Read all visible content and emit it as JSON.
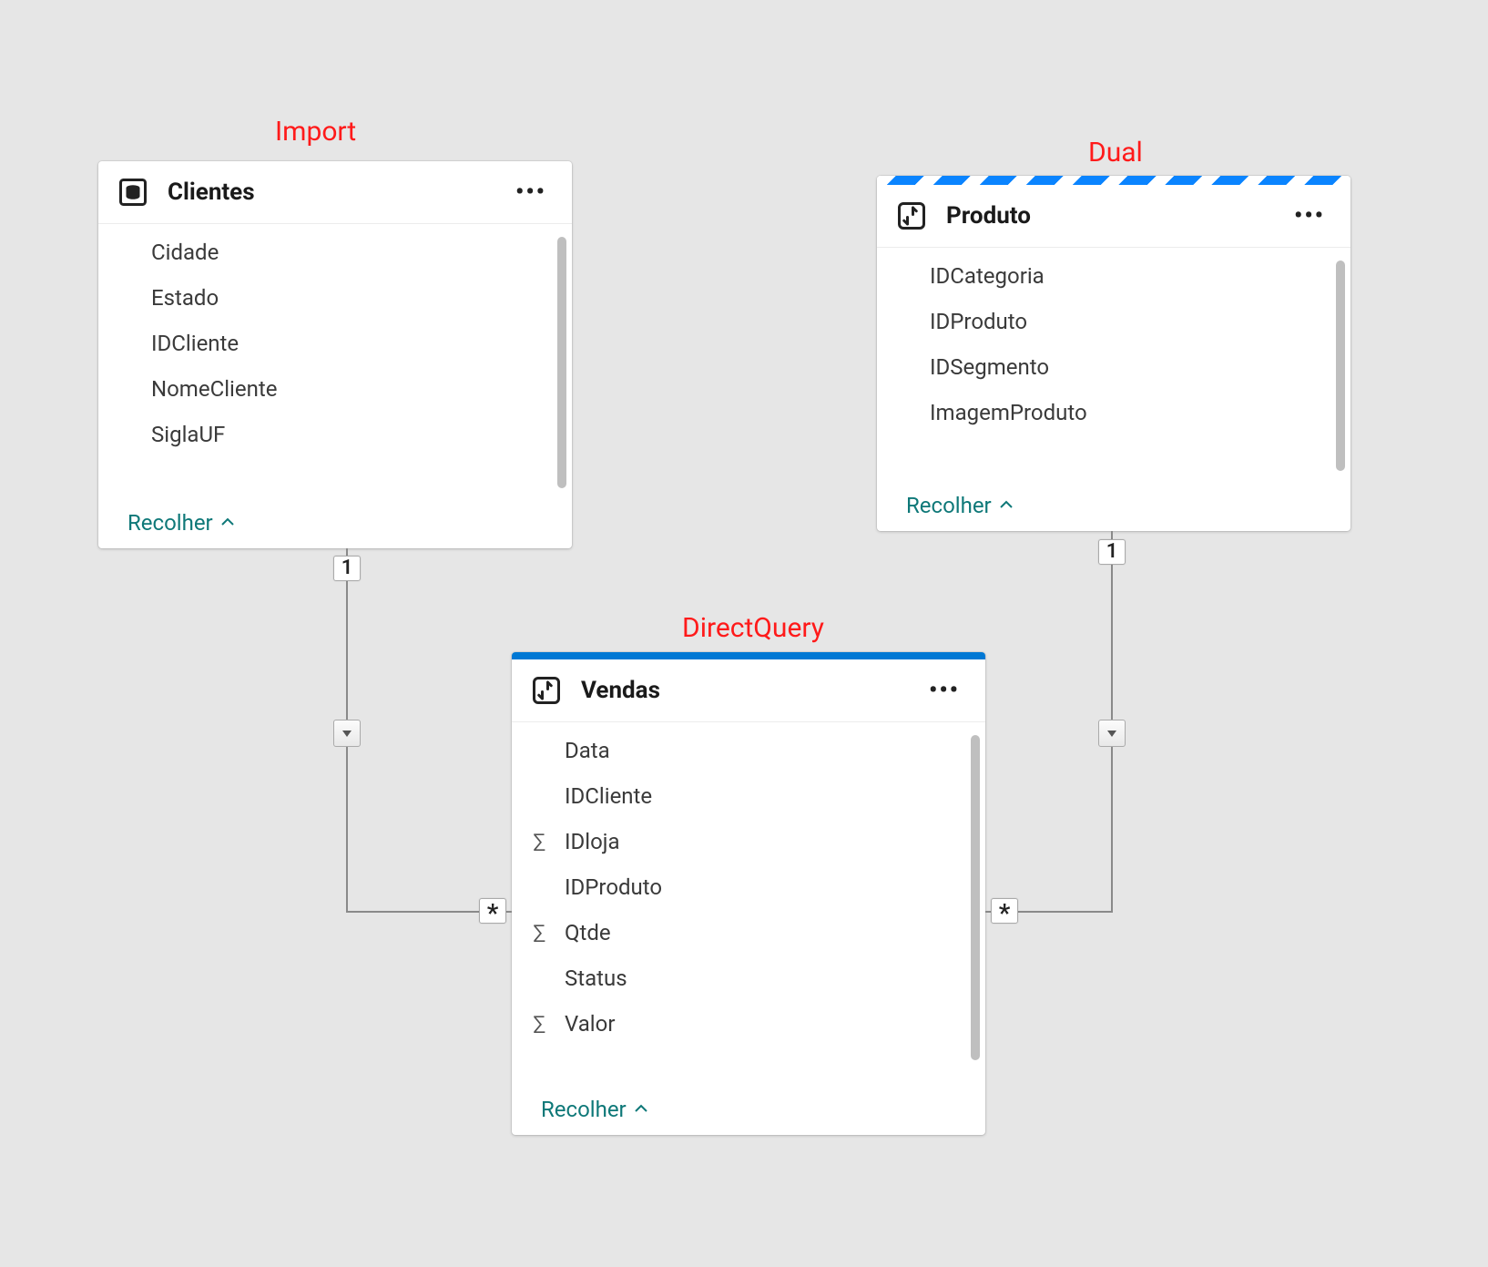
{
  "labels": {
    "import": "Import",
    "dual": "Dual",
    "directquery": "DirectQuery"
  },
  "clientes": {
    "title": "Clientes",
    "fields": [
      "Cidade",
      "Estado",
      "IDCliente",
      "NomeCliente",
      "SiglaUF"
    ],
    "collapse": "Recolher"
  },
  "produto": {
    "title": "Produto",
    "fields": [
      "IDCategoria",
      "IDProduto",
      "IDSegmento",
      "ImagemProduto"
    ],
    "collapse": "Recolher"
  },
  "vendas": {
    "title": "Vendas",
    "fields": [
      {
        "name": "Data",
        "agg": false
      },
      {
        "name": "IDCliente",
        "agg": false
      },
      {
        "name": "IDloja",
        "agg": true
      },
      {
        "name": "IDProduto",
        "agg": false
      },
      {
        "name": "Qtde",
        "agg": true
      },
      {
        "name": "Status",
        "agg": false
      },
      {
        "name": "Valor",
        "agg": true
      }
    ],
    "collapse": "Recolher"
  },
  "relationships": [
    {
      "from": "Clientes",
      "fromCardinality": "1",
      "to": "Vendas",
      "toCardinality": "*",
      "filterDirection": "single"
    },
    {
      "from": "Produto",
      "fromCardinality": "1",
      "to": "Vendas",
      "toCardinality": "*",
      "filterDirection": "single"
    }
  ]
}
